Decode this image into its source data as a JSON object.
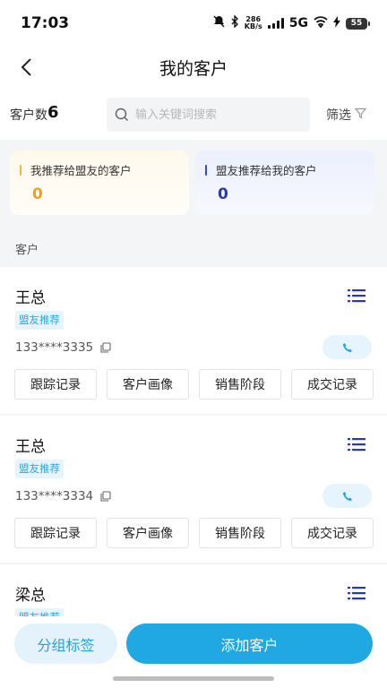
{
  "status_bar": {
    "time": "17:03",
    "speed_value": "286",
    "speed_unit": "KB/s",
    "network": "5G",
    "battery": "55"
  },
  "nav": {
    "title": "我的客户"
  },
  "search_row": {
    "count_label": "客户数",
    "count_value": "6",
    "search_placeholder": "输入关键词搜索",
    "filter_label": "筛选"
  },
  "referral_cards": [
    {
      "label": "我推荐给盟友的客户",
      "value": "0",
      "accent": "#f1b43c"
    },
    {
      "label": "盟友推荐给我的客户",
      "value": "0",
      "accent": "#3548c8"
    }
  ],
  "section_label": "客户",
  "customers": [
    {
      "name": "王总",
      "tag": "盟友推荐",
      "phone": "133****3335"
    },
    {
      "name": "王总",
      "tag": "盟友推荐",
      "phone": "133****3334"
    },
    {
      "name": "梁总",
      "tag": "盟友推荐",
      "phone": ""
    }
  ],
  "card_actions": [
    "跟踪记录",
    "客户画像",
    "销售阶段",
    "成交记录"
  ],
  "bottom_bar": {
    "group_label": "分组标签",
    "add_label": "添加客户"
  },
  "colors": {
    "accent": "#1fa8e2",
    "tag_text": "#2aa5dd",
    "icon_blue": "#2b35c4"
  }
}
